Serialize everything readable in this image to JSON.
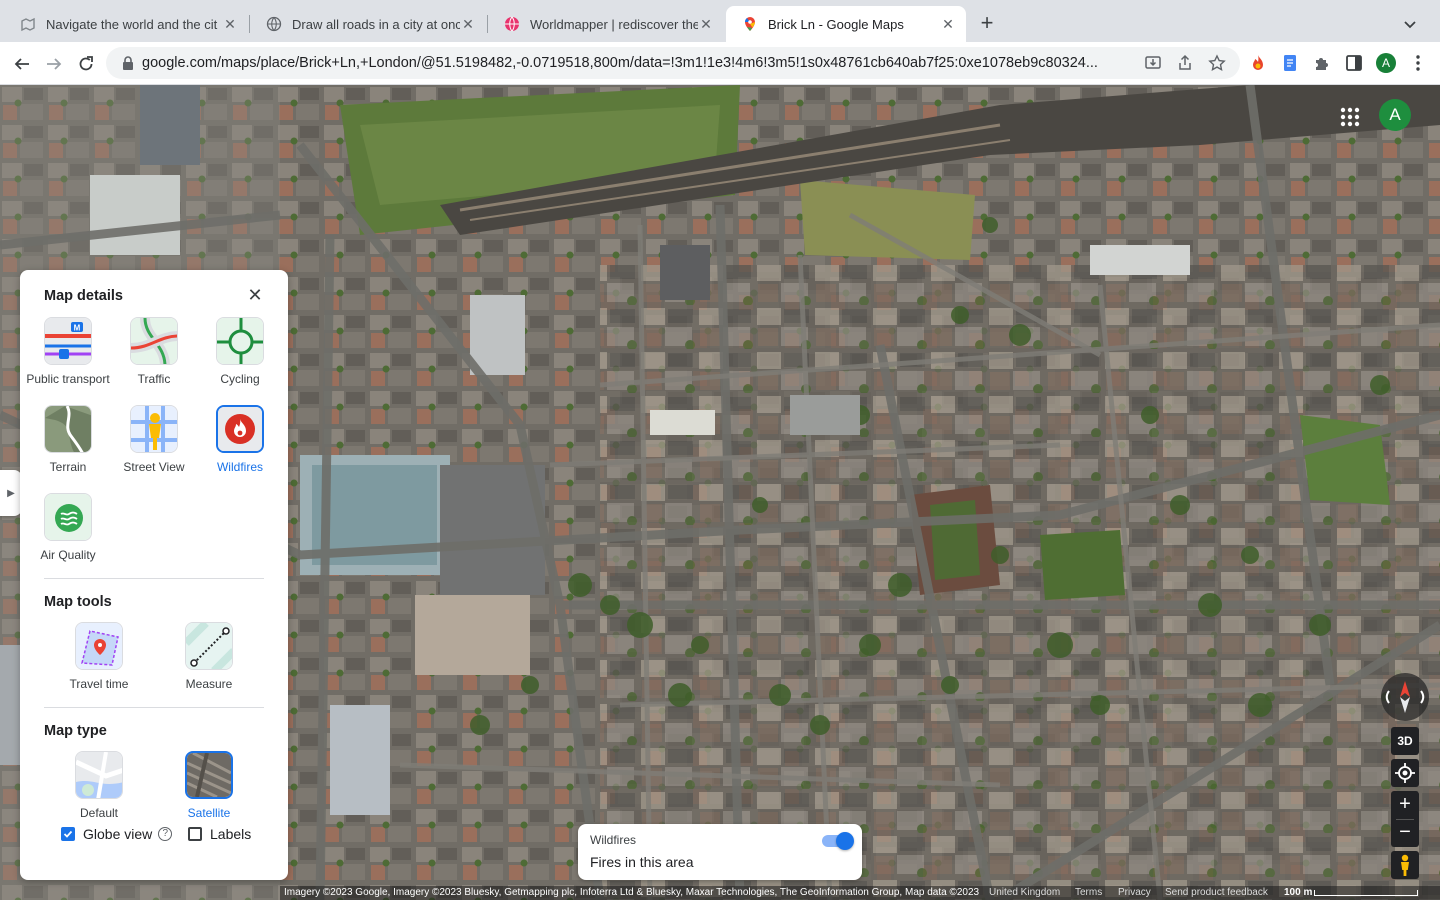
{
  "browser": {
    "tabs": [
      {
        "title": "Navigate the world and the cit",
        "icon": "map-pin-gray-icon",
        "active": false
      },
      {
        "title": "Draw all roads in a city at once",
        "icon": "globe-icon",
        "active": false
      },
      {
        "title": "Worldmapper | rediscover the",
        "icon": "worldmapper-globe-icon",
        "active": false
      },
      {
        "title": "Brick Ln - Google Maps",
        "icon": "google-maps-pin-icon",
        "active": true
      }
    ],
    "new_tab": "+",
    "url": "google.com/maps/place/Brick+Ln,+London/@51.5198482,-0.0719518,800m/data=!3m1!1e3!4m6!3m5!1s0x48761cb640ab7f25:0xe1078eb9c80324...",
    "profile_initial": "A"
  },
  "maps": {
    "account_initial": "A",
    "panel": {
      "title": "Map details",
      "layers": [
        {
          "label": "Public transport",
          "selected": false
        },
        {
          "label": "Traffic",
          "selected": false
        },
        {
          "label": "Cycling",
          "selected": false
        },
        {
          "label": "Terrain",
          "selected": false
        },
        {
          "label": "Street View",
          "selected": false
        },
        {
          "label": "Wildfires",
          "selected": true
        },
        {
          "label": "Air Quality",
          "selected": false
        }
      ],
      "tools_title": "Map tools",
      "tools": [
        {
          "label": "Travel time"
        },
        {
          "label": "Measure"
        }
      ],
      "type_title": "Map type",
      "types": [
        {
          "label": "Default",
          "selected": false
        },
        {
          "label": "Satellite",
          "selected": true
        }
      ],
      "globe_view": {
        "label": "Globe view",
        "checked": true
      },
      "labels": {
        "label": "Labels",
        "checked": false
      }
    },
    "wildfire_card": {
      "title": "Wildfires",
      "subtitle": "Fires in this area",
      "enabled": true
    },
    "controls": {
      "three_d": "3D"
    },
    "footer": {
      "imagery": "Imagery ©2023 Google, Imagery ©2023 Bluesky, Getmapping plc, Infoterra Ltd & Bluesky, Maxar Technologies, The GeoInformation Group, Map data ©2023",
      "region": "United Kingdom",
      "terms": "Terms",
      "privacy": "Privacy",
      "feedback": "Send product feedback",
      "scale": "100 m"
    },
    "colors": {
      "accent": "#1a73e8",
      "avatar": "#1e8e3e"
    }
  }
}
